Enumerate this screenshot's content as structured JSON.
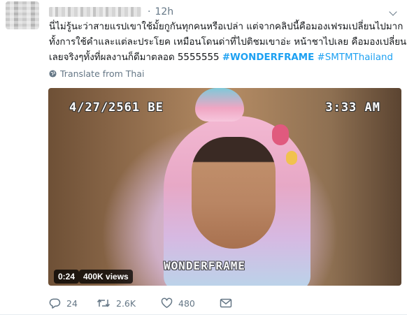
{
  "tweet": {
    "author_name": "",
    "separator": "·",
    "time": "12h",
    "text_lines": [
      "นี่ไม่รู้นะว่าสายแรปเขาใช้มั้ยกูกันทุกคนหรือเปล่า แต่จากคลิปนี้คือมองเฟรมเปลี่ยนไปมาก",
      "ทั้งการใช้คำและแต่ละประโยค เหมือนโดนด่าที่ไปติชมเขาอ่ะ หน้าชาไปเลย  คือมองเปลี่ยน",
      "เลยจริงๆทั้งที่ผลงานก็ดีมาตลอด 5555555"
    ],
    "hashtags": [
      "#WONDERFRAME",
      "#SMTMThailand"
    ],
    "translate_label": "Translate from Thai",
    "video": {
      "date_overlay": "4/27/2561 BE",
      "time_overlay": "3:33 AM",
      "watermark": "WONDERFRAME",
      "duration": "0:24",
      "views": "400K views"
    },
    "actions": {
      "reply_count": "24",
      "retweet_count": "2.6K",
      "like_count": "480"
    }
  },
  "icons": {
    "globe": "globe-icon",
    "reply": "reply-icon",
    "retweet": "retweet-icon",
    "like": "heart-icon",
    "dm": "envelope-icon",
    "menu": "chevron-down-icon"
  },
  "colors": {
    "link": "#1da1f2",
    "muted": "#657786",
    "text": "#14171a"
  }
}
